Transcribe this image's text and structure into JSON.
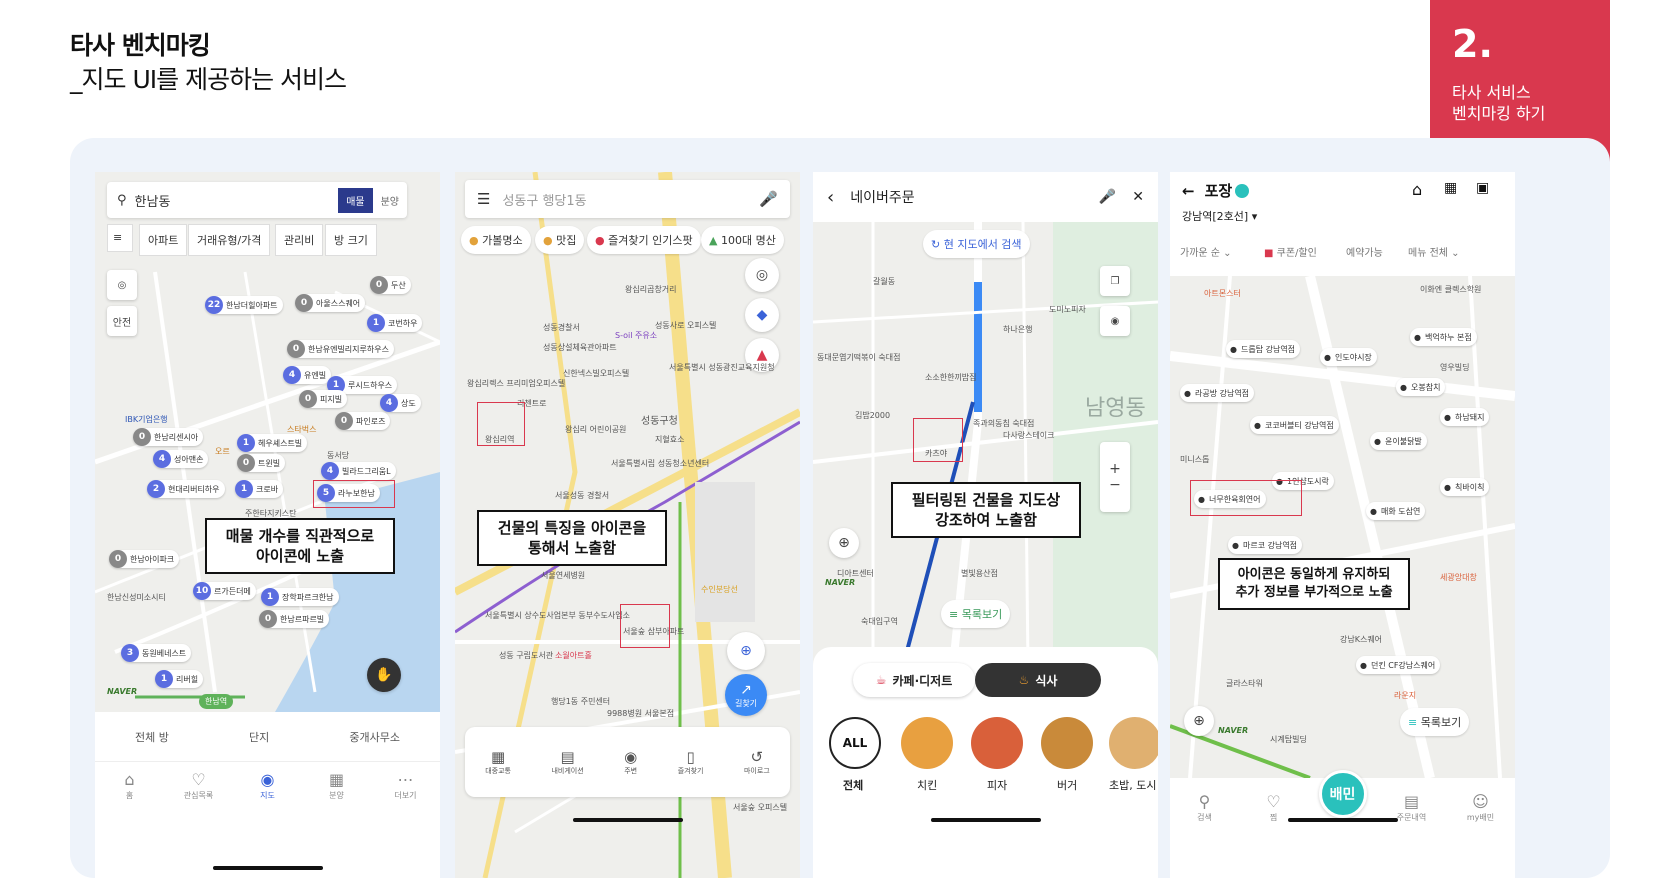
{
  "header": {
    "title": "타사 벤치마킹",
    "subtitle": "_지도 UI를 제공하는 서비스"
  },
  "tag": {
    "number": "2",
    "dot": ".",
    "line1": "타사 서비스",
    "line2": "벤치마킹 하기"
  },
  "colors": {
    "accent": "#d9384e",
    "panel": "#eef3fa",
    "pin_blue": "#5b6de0",
    "route_blue": "#2d7be6"
  },
  "phone1": {
    "search_text": "한남동",
    "toggle": [
      "매물",
      "분양"
    ],
    "filters": [
      "아파트",
      "거래유형/가격",
      "관리비",
      "방 크기"
    ],
    "side_buttons": [
      "안전"
    ],
    "pins": [
      {
        "count": "22",
        "name": "한남더힐아파트"
      },
      {
        "count": "0",
        "name": "아울스스퀘어"
      },
      {
        "count": "0",
        "name": "두산"
      },
      {
        "count": "1",
        "name": "코번하우"
      },
      {
        "count": "0",
        "name": "한남유엔빌리지루하우스"
      },
      {
        "count": "4",
        "name": "유엔빌"
      },
      {
        "count": "1",
        "name": "루시드하우스"
      },
      {
        "count": "0",
        "name": "피지빌"
      },
      {
        "count": "4",
        "name": "상도"
      },
      {
        "count": "0",
        "name": "파인로즈"
      },
      {
        "count": "1",
        "name": "헤우셰스트빌"
      },
      {
        "count": "0",
        "name": "한남리센시아"
      },
      {
        "count": "4",
        "name": "성아맨손"
      },
      {
        "count": "0",
        "name": "트윈빌"
      },
      {
        "count": "4",
        "name": "빌라드그리움L"
      },
      {
        "count": "2",
        "name": "현대리버티하우"
      },
      {
        "count": "1",
        "name": "크로바"
      },
      {
        "count": "5",
        "name": "라누보한남"
      },
      {
        "count": "0",
        "name": "한남아이파크"
      },
      {
        "count": "10",
        "name": "르가든더메"
      },
      {
        "count": "1",
        "name": "장학파르크한남"
      },
      {
        "count": "0",
        "name": "한남르파르빌"
      },
      {
        "count": "3",
        "name": "동원베네스트"
      },
      {
        "count": "1",
        "name": "리버힐"
      }
    ],
    "map_labels": [
      "IBK기업은행",
      "스타벅스",
      "동서당",
      "한남신성미소시티",
      "한남역",
      "주한타지키스탄",
      "오르"
    ],
    "callout": [
      "매물 개수를 직관적으로",
      "아이콘에 노출"
    ],
    "bottom_tabs": [
      "전체 방",
      "단지",
      "중개사무소"
    ],
    "nav": [
      "홈",
      "관심목록",
      "지도",
      "분양",
      "더보기"
    ]
  },
  "phone2": {
    "search_placeholder": "성동구 행당1동",
    "chips": [
      "가볼명소",
      "맛집",
      "즐겨찾기 인기스팟",
      "100대 명산"
    ],
    "map_labels": [
      "왕십리곱창거리",
      "성동경찰서",
      "성동사로 오피스텔",
      "성동상설체육관아파트",
      "S-oil 주유소",
      "신한넥스빌오피스텔",
      "왕십리렉스 프리미엄오피스텔",
      "리첸트로",
      "서울특별시 성동광진교육지원청",
      "왕십리 어린이공원",
      "성동구청",
      "왕십리역",
      "지혈효소",
      "서울특별시립 성동청소년센터",
      "서울성동 경찰서",
      "서울연세병원",
      "서울특별시 상수도사업본부 동부수도사업소",
      "성동 구립도서관",
      "서울숲 삼부아파트",
      "행당1동 주민센터",
      "9988병원 서울본점",
      "서울숲 오피스텔",
      "소월아트홀",
      "수인분당선"
    ],
    "callout": [
      "건물의 특징을 아이콘을",
      "통해서 노출함"
    ],
    "nav": [
      "대중교통",
      "내비게이션",
      "주변",
      "즐겨찾기",
      "마이로그"
    ],
    "fab": "길찾기"
  },
  "phone3": {
    "search_text": "네이버주문",
    "area_search": "현 지도에서 검색",
    "map_labels": [
      "동대문엽기떡볶이 숙대점",
      "소소한한끼밥집",
      "하나은행",
      "김밥2000",
      "족과의동침 숙대점",
      "다사랑스테이크",
      "카츠야",
      "남영동",
      "숙대입구역",
      "갈월동",
      "별빛용산점",
      "도미노피자",
      "디아트센터"
    ],
    "callout": [
      "필터링된 건물을 지도상",
      "강조하여 노출함"
    ],
    "list_button": "목록보기",
    "tabs": [
      "카페·디저트",
      "식사"
    ],
    "categories": [
      "전체",
      "치킨",
      "피자",
      "버거",
      "초밥, 도시"
    ],
    "all_chip": "ALL"
  },
  "phone4": {
    "title": "포장",
    "location": "강남역[2호선]",
    "filters": [
      "가까운 순",
      "쿠폰/할인",
      "예약가능",
      "메뉴 전체"
    ],
    "map_labels": [
      "아트몬스터",
      "이화엔 클렉스학원",
      "백억하누 본점",
      "드롭탑 강남역점",
      "인도야시장",
      "영우빌딩",
      "라공방 강남역점",
      "오봉참치",
      "코코버블티 강남역점",
      "윤이불닭발",
      "하남돼지",
      "미니스톱",
      "1인샵도시락",
      "너무한육회연어",
      "매화 도삼연",
      "칙바이칙",
      "마르코 강남역점",
      "세광앙대창",
      "강남K스퀘어",
      "던킨 CF강남스퀘어",
      "글라스타워",
      "시계탑빌딩",
      "라운지"
    ],
    "callout": [
      "아이콘은 동일하게 유지하되",
      "추가 정보를 부가적으로 노출"
    ],
    "list_button": "목록보기",
    "nav": [
      "검색",
      "찜",
      "배민",
      "주문내역",
      "my배민"
    ]
  }
}
